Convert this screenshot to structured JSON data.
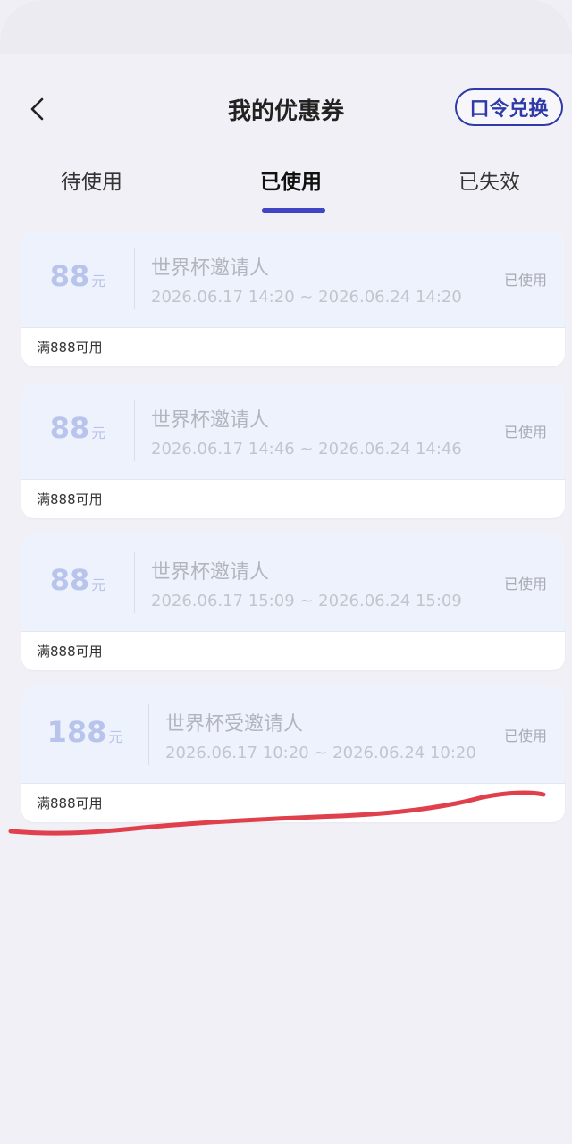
{
  "header": {
    "title": "我的优惠券",
    "redeem_label": "口令兑换"
  },
  "tabs": [
    {
      "label": "待使用",
      "active": false
    },
    {
      "label": "已使用",
      "active": true
    },
    {
      "label": "已失效",
      "active": false
    }
  ],
  "coupons": [
    {
      "amount": "88",
      "unit": "元",
      "name": "世界杯邀请人",
      "period": "2026.06.17 14:20 ~ 2026.06.24 14:20",
      "status": "已使用",
      "condition": "满888可用"
    },
    {
      "amount": "88",
      "unit": "元",
      "name": "世界杯邀请人",
      "period": "2026.06.17 14:46 ~ 2026.06.24 14:46",
      "status": "已使用",
      "condition": "满888可用"
    },
    {
      "amount": "88",
      "unit": "元",
      "name": "世界杯邀请人",
      "period": "2026.06.17 15:09 ~ 2026.06.24 15:09",
      "status": "已使用",
      "condition": "满888可用"
    },
    {
      "amount": "188",
      "unit": "元",
      "name": "世界杯受邀请人",
      "period": "2026.06.17 10:20 ~ 2026.06.24 10:20",
      "status": "已使用",
      "condition": "满888可用"
    }
  ],
  "colors": {
    "accent": "#2f3aa8",
    "tab_indicator": "#3f45c3",
    "annotation_stroke": "#e0404c"
  }
}
